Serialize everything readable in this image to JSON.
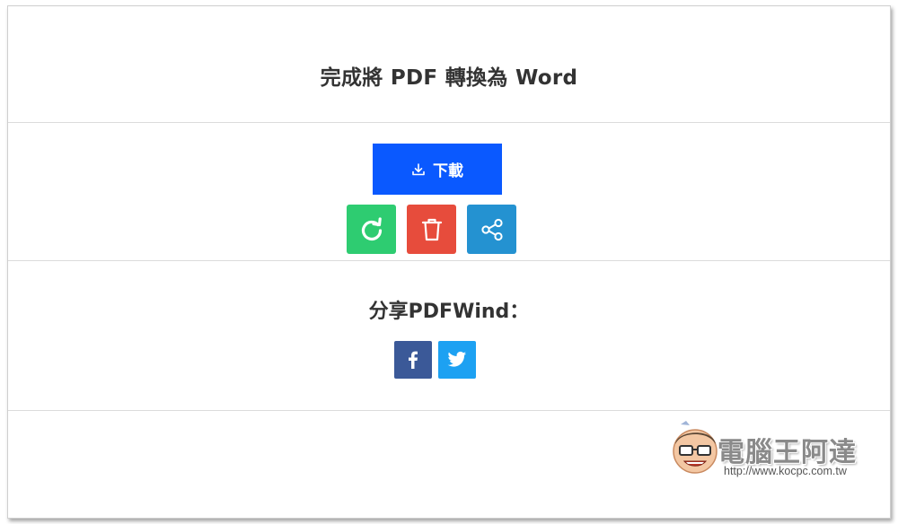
{
  "header": {
    "title": "完成將 PDF 轉換為 Word"
  },
  "actions": {
    "download_label": "下載",
    "colors": {
      "download": "#0a59ff",
      "restart": "#2ecc71",
      "delete": "#e74c3c",
      "share": "#2492d1"
    },
    "icons": [
      "download-icon",
      "restart-icon",
      "trash-icon",
      "share-icon"
    ]
  },
  "share": {
    "title": "分享PDFWind：",
    "networks": [
      {
        "name": "facebook",
        "icon": "facebook-icon",
        "color": "#3b5998"
      },
      {
        "name": "twitter",
        "icon": "twitter-icon",
        "color": "#1da1f2"
      }
    ]
  },
  "watermark": {
    "name": "電腦王阿達",
    "url": "http://www.kocpc.com.tw"
  }
}
